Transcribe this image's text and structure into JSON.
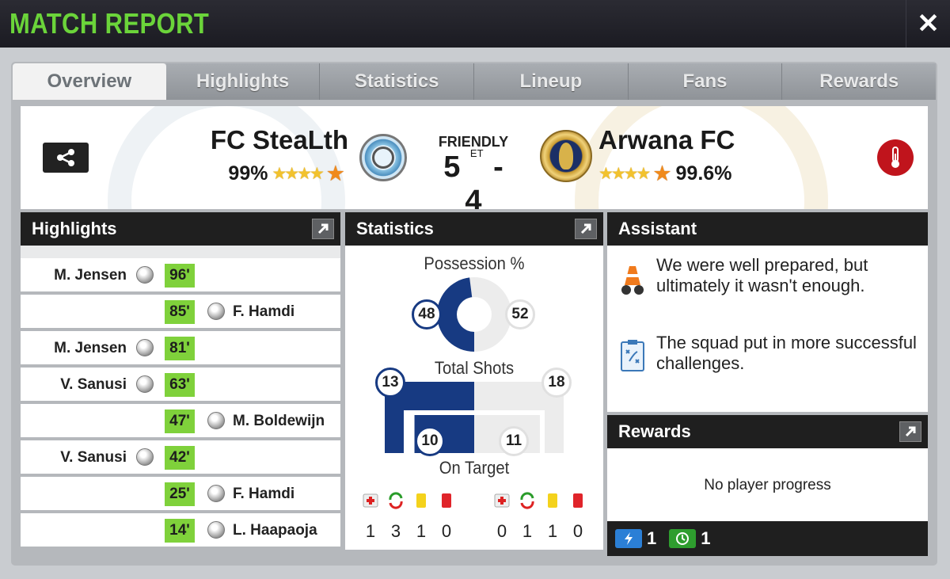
{
  "header": {
    "title": "MATCH REPORT",
    "close_icon": "close-icon"
  },
  "tabs": [
    {
      "label": "Overview",
      "active": true
    },
    {
      "label": "Highlights",
      "active": false
    },
    {
      "label": "Statistics",
      "active": false
    },
    {
      "label": "Lineup",
      "active": false
    },
    {
      "label": "Fans",
      "active": false
    },
    {
      "label": "Rewards",
      "active": false
    }
  ],
  "match": {
    "type": "FRIENDLY",
    "home": {
      "name": "FC SteaLth",
      "rating": "99%",
      "stars": 5
    },
    "away": {
      "name": "Arwana FC",
      "rating": "99.6%",
      "stars": 5
    },
    "home_score": "5",
    "away_score": "4",
    "extra_time": "ET"
  },
  "highlights": {
    "title": "Highlights",
    "events": [
      {
        "minute": "96'",
        "player": "M. Jensen",
        "side": "home"
      },
      {
        "minute": "85'",
        "player": "F. Hamdi",
        "side": "away"
      },
      {
        "minute": "81'",
        "player": "M. Jensen",
        "side": "home"
      },
      {
        "minute": "63'",
        "player": "V. Sanusi",
        "side": "home"
      },
      {
        "minute": "47'",
        "player": "M. Boldewijn",
        "side": "away"
      },
      {
        "minute": "42'",
        "player": "V. Sanusi",
        "side": "home"
      },
      {
        "minute": "25'",
        "player": "F. Hamdi",
        "side": "away"
      },
      {
        "minute": "14'",
        "player": "L. Haapaoja",
        "side": "away"
      }
    ]
  },
  "statistics": {
    "title": "Statistics",
    "possession_label": "Possession %",
    "possession_home": "48",
    "possession_away": "52",
    "shots_label": "Total Shots",
    "shots_home": "13",
    "shots_away": "18",
    "on_target_label": "On Target",
    "on_target_home": "10",
    "on_target_away": "11",
    "home_events": [
      "1",
      "3",
      "1",
      "0"
    ],
    "away_events": [
      "0",
      "1",
      "1",
      "0"
    ],
    "home_color": "#173a82",
    "away_color": "#ececec"
  },
  "assistant": {
    "title": "Assistant",
    "tips": [
      "We were well prepared, but ultimately it wasn't enough.",
      "The squad put in more successful challenges."
    ]
  },
  "rewards": {
    "title": "Rewards",
    "message": "No player progress",
    "energy": "1",
    "recovery": "1"
  }
}
